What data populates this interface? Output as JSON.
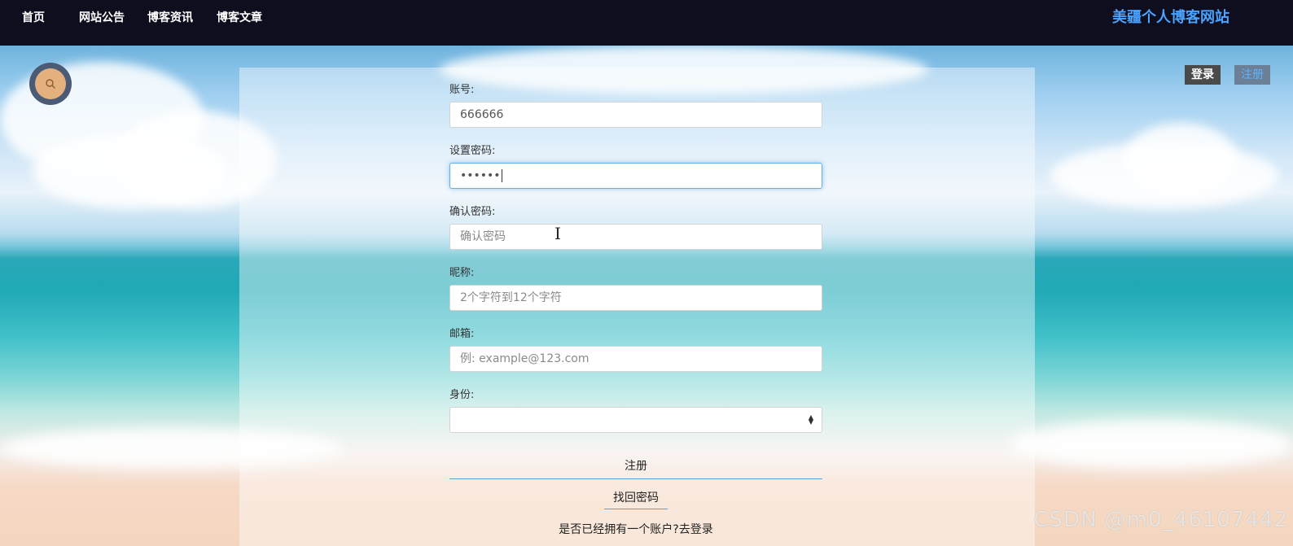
{
  "nav": {
    "items": [
      "首页",
      "网站公告",
      "博客资讯",
      "博客文章"
    ],
    "site_title": "美疆个人博客网站"
  },
  "auth": {
    "login_label": "登录",
    "register_label": "注册"
  },
  "form": {
    "account": {
      "label": "账号:",
      "value": "666666"
    },
    "password": {
      "label": "设置密码:",
      "value": "••••••"
    },
    "confirm": {
      "label": "确认密码:",
      "placeholder": "确认密码"
    },
    "nickname": {
      "label": "昵称:",
      "placeholder": "2个字符到12个字符"
    },
    "email": {
      "label": "邮箱:",
      "placeholder": "例: example@123.com"
    },
    "role": {
      "label": "身份:",
      "value": ""
    },
    "submit_label": "注册",
    "forgot_label": "找回密码",
    "login_prompt": "是否已经拥有一个账户?去登录"
  },
  "watermark": "CSDN @m0_46107442",
  "icons": {
    "search": "search-icon",
    "select": "select-arrows-icon"
  },
  "colors": {
    "nav_bg": "#0f0e1e",
    "site_title": "#4aa3ff",
    "focus": "#66afe9"
  }
}
